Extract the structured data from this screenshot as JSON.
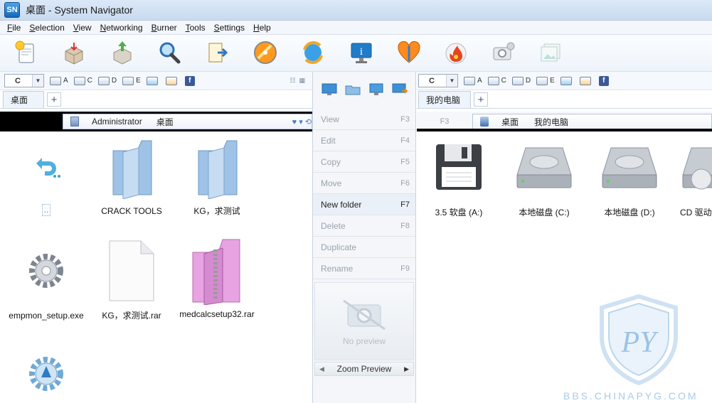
{
  "window": {
    "title": "桌面 - System Navigator",
    "app_icon_text": "SN"
  },
  "menu": [
    "File",
    "Selection",
    "View",
    "Networking",
    "Burner",
    "Tools",
    "Settings",
    "Help"
  ],
  "toolbar": {
    "icons": [
      "new-document-icon",
      "open-box-icon",
      "upload-box-icon",
      "search-magnifier-icon",
      "export-document-icon",
      "orange-disc-icon",
      "sync-globe-icon",
      "info-monitor-icon",
      "heart-shield-icon",
      "flame-disc-icon",
      "camera-icon",
      "gallery-icon"
    ]
  },
  "left": {
    "drive": "C",
    "drive_buttons": [
      "A",
      "C",
      "D",
      "E"
    ],
    "tab": "桌面",
    "address": {
      "user": "Administrator",
      "folder": "桌面"
    },
    "items": [
      {
        "name": "..",
        "type": "up"
      },
      {
        "name": "CRACK TOOLS",
        "type": "folder"
      },
      {
        "name": "KG，求测试",
        "type": "folder"
      },
      {
        "name": "empmon_setup.exe",
        "type": "exe"
      },
      {
        "name": "KG，求测试.rar",
        "type": "file"
      },
      {
        "name": "medcalcsetup32.rar",
        "type": "rar"
      },
      {
        "name": "",
        "type": "exe2"
      }
    ]
  },
  "middle": {
    "actions": [
      {
        "label": "View",
        "key": "F3",
        "enabled": false
      },
      {
        "label": "Edit",
        "key": "F4",
        "enabled": false
      },
      {
        "label": "Copy",
        "key": "F5",
        "enabled": false
      },
      {
        "label": "Move",
        "key": "F6",
        "enabled": false
      },
      {
        "label": "New folder",
        "key": "F7",
        "enabled": true
      },
      {
        "label": "Delete",
        "key": "F8",
        "enabled": false
      },
      {
        "label": "Duplicate",
        "key": "",
        "enabled": false
      },
      {
        "label": "Rename",
        "key": "F9",
        "enabled": false
      }
    ],
    "preview_text": "No preview",
    "zoom_label": "Zoom Preview"
  },
  "right": {
    "drive": "C",
    "drive_buttons": [
      "A",
      "C",
      "D",
      "E"
    ],
    "tab": "我的电脑",
    "key_hint": "F3",
    "address": {
      "root": "桌面",
      "folder": "我的电脑"
    },
    "items": [
      {
        "name": "3.5 软盘 (A:)",
        "type": "floppy"
      },
      {
        "name": "本地磁盘 (C:)",
        "type": "hdd"
      },
      {
        "name": "本地磁盘 (D:)",
        "type": "hdd"
      },
      {
        "name": "CD 驱动",
        "type": "cd"
      }
    ]
  },
  "watermark": {
    "text": "BBS.CHINAPYG.COM",
    "logo_letters": "PY"
  }
}
